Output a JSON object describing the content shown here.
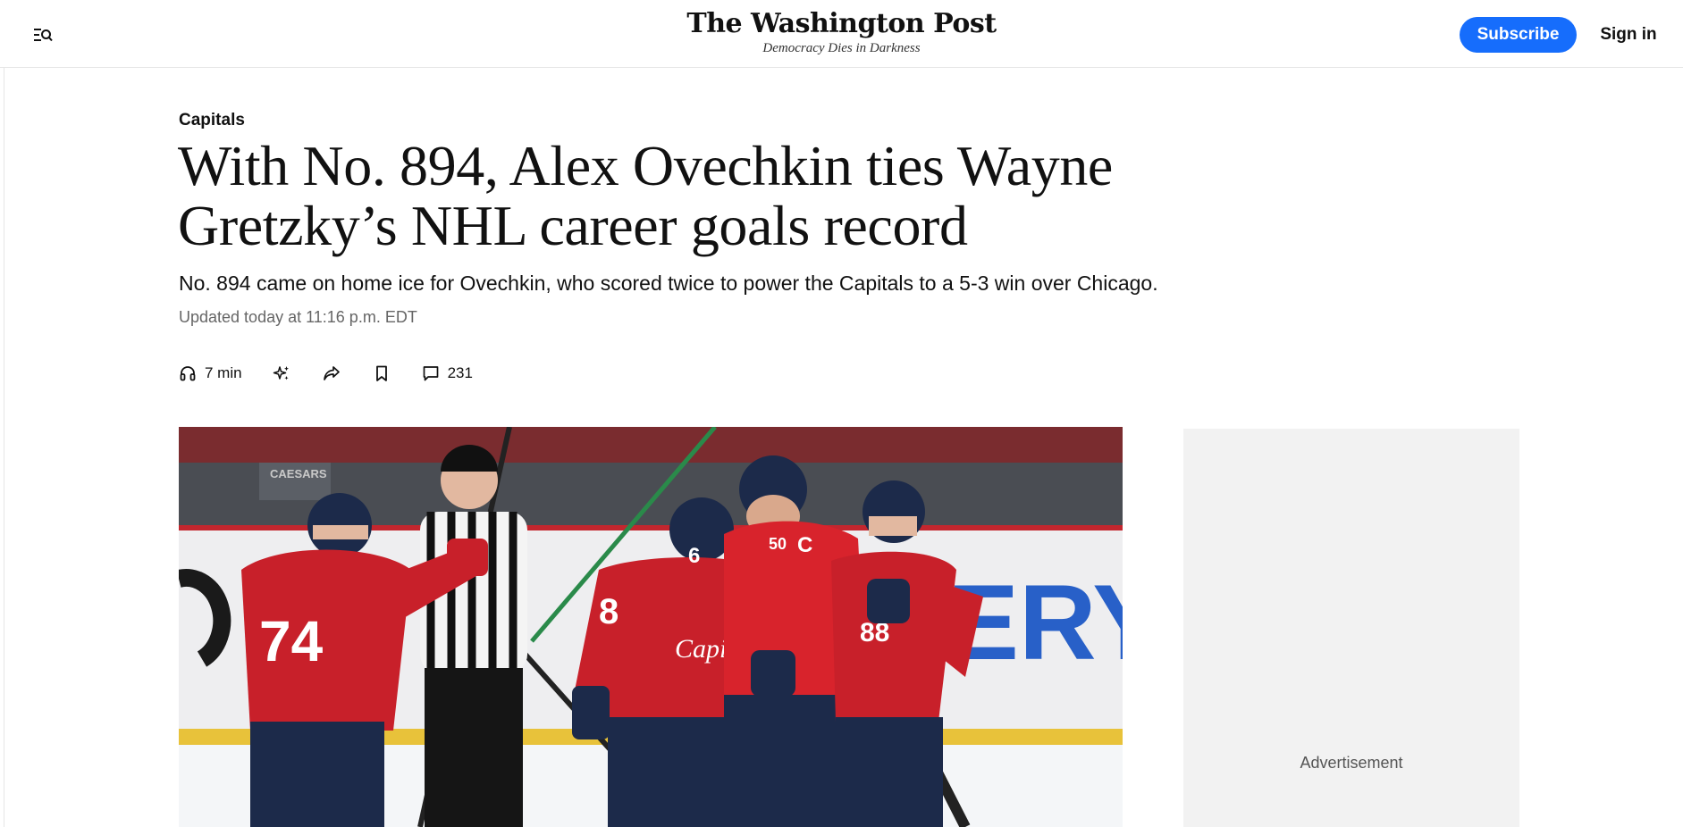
{
  "header": {
    "logo_text": "The Washington Post",
    "tagline": "Democracy Dies in Darkness",
    "subscribe_label": "Subscribe",
    "signin_label": "Sign in",
    "menu_icon": "menu-search-icon",
    "accent_color": "#166dfc"
  },
  "article": {
    "section": "Capitals",
    "headline_line1": "With No. 894, Alex Ovechkin ties Wayne",
    "headline_line2": "Gretzky’s NHL career goals record",
    "subheadline": "No. 894 came on home ice for Ovechkin, who scored twice to power the Capitals to a 5-3 win over Chicago.",
    "timestamp": "Updated today at 11:16 p.m. EDT"
  },
  "actions": {
    "listen": {
      "icon": "headphones-icon",
      "label": "7 min"
    },
    "summary": {
      "icon": "sparkle-icon"
    },
    "share": {
      "icon": "share-icon"
    },
    "save": {
      "icon": "bookmark-icon"
    },
    "comments": {
      "icon": "comment-icon",
      "count": "231"
    }
  },
  "hero_image": {
    "boards_text": "ERY",
    "arena_sign": "CAESARS",
    "jersey_numbers": [
      "74",
      "6",
      "8",
      "88",
      "50",
      "C"
    ],
    "team_wordmark": "Capitals"
  },
  "ad": {
    "label": "Advertisement"
  }
}
